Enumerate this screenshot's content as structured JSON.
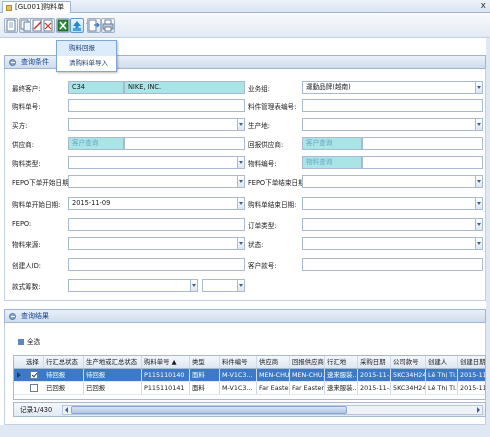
{
  "tab": {
    "title": "[GL001]购料单"
  },
  "window": {
    "close_glyph": "x"
  },
  "toolbar": {
    "icons": [
      "new-icon",
      "copy-icon",
      "edit-icon",
      "delete-icon",
      "excel-icon",
      "upload-icon",
      "export-icon",
      "print-icon"
    ]
  },
  "menu": {
    "items": [
      "购料回报",
      "清购料单导入"
    ]
  },
  "query": {
    "header": "查询条件",
    "fields": {
      "ultimate_customer": {
        "label": "最终客户:",
        "code": "C34",
        "name": "NIKE, INC."
      },
      "business_unit": {
        "label": "业务组:",
        "value": "運動品牌(越南)"
      },
      "po_no": {
        "label": "购料单号:",
        "value": ""
      },
      "mgmt_no": {
        "label": "料件管理表编号:",
        "value": ""
      },
      "buyer": {
        "label": "买方:",
        "value": ""
      },
      "production_site": {
        "label": "生产地:",
        "value": ""
      },
      "supplier": {
        "label": "供应商:",
        "placeholder": "客户查询"
      },
      "report_supplier": {
        "label": "回报供应商:",
        "placeholder": "客户查询"
      },
      "po_type": {
        "label": "购料类型:",
        "value": ""
      },
      "material_no": {
        "label": "物料编号:",
        "placeholder": "物料查询"
      },
      "fepo_start": {
        "label": "FEPO下单开始日期:",
        "value": ""
      },
      "fepo_end": {
        "label": "FEPO下单结束日期:",
        "value": ""
      },
      "po_start": {
        "label": "购料单开始日期:",
        "value": "2015-11-09"
      },
      "po_end": {
        "label": "购料单结束日期:",
        "value": ""
      },
      "fepo": {
        "label": "FEPO:",
        "value": ""
      },
      "order_type": {
        "label": "订单类型:",
        "value": ""
      },
      "material_source": {
        "label": "物料来源:",
        "value": ""
      },
      "status": {
        "label": "状态:",
        "value": ""
      },
      "creator_id": {
        "label": "创建人ID:",
        "value": ""
      },
      "customer_no": {
        "label": "客户款号:",
        "value": ""
      },
      "qty_rule": {
        "label": "款式筹数:",
        "value": "",
        "value2": ""
      }
    }
  },
  "results": {
    "header": "查询结果",
    "select_all": "全选",
    "columns": [
      "选择",
      "行汇总状态",
      "生产地或汇总状态",
      "购料单号",
      "类型",
      "料件编号",
      "供应商",
      "回报供应商",
      "行汇地",
      "采购日期",
      "公司款号",
      "创建人",
      "创建日期"
    ],
    "sort_column_indicator": "▲",
    "rows": [
      {
        "checked": true,
        "selected": true,
        "cells": [
          "待回报",
          "待回报",
          "P115110140",
          "面料",
          "M-V1C3...",
          "MEN-CHU...",
          "MEN-CHU...",
          "速来服装...",
          "2015-11-...",
          "5KC34H24",
          "Lê Thị Tl...",
          "2015-11-"
        ]
      },
      {
        "checked": false,
        "selected": false,
        "cells": [
          "已回报",
          "已回报",
          "P115110141",
          "面料",
          "M-V1C3...",
          "Far Eastern...",
          "Far Eastern...",
          "速来服装...",
          "2015-11-...",
          "5KC34H24",
          "Lê Thị Tl...",
          "2015-11-"
        ]
      }
    ],
    "record_text": "记录1/430"
  }
}
